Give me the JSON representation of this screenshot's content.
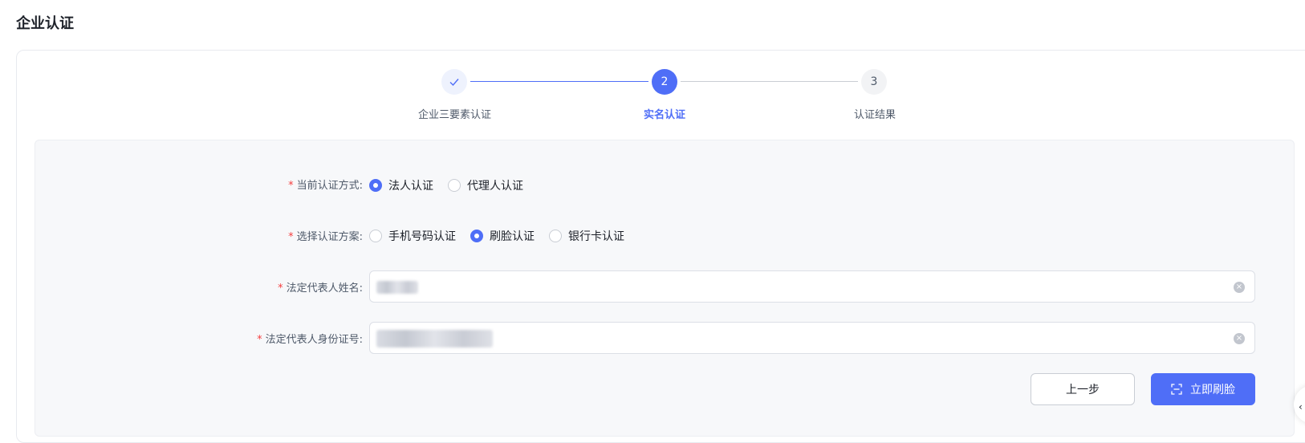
{
  "page": {
    "title": "企业认证"
  },
  "steps": [
    {
      "number": "✓",
      "label": "企业三要素认证",
      "state": "done"
    },
    {
      "number": "2",
      "label": "实名认证",
      "state": "active"
    },
    {
      "number": "3",
      "label": "认证结果",
      "state": "todo"
    }
  ],
  "form": {
    "auth_method": {
      "label": "当前认证方式:",
      "options": [
        "法人认证",
        "代理人认证"
      ],
      "selected": "法人认证"
    },
    "auth_plan": {
      "label": "选择认证方案:",
      "options": [
        "手机号码认证",
        "刷脸认证",
        "银行卡认证"
      ],
      "selected": "刷脸认证"
    },
    "legal_rep_name": {
      "label": "法定代表人姓名:",
      "value": ""
    },
    "legal_rep_id": {
      "label": "法定代表人身份证号:",
      "value": ""
    },
    "required_mark": "*"
  },
  "buttons": {
    "prev": "上一步",
    "face": "立即刷脸"
  },
  "colors": {
    "primary": "#4f6ef7",
    "required": "#f53f3f"
  }
}
